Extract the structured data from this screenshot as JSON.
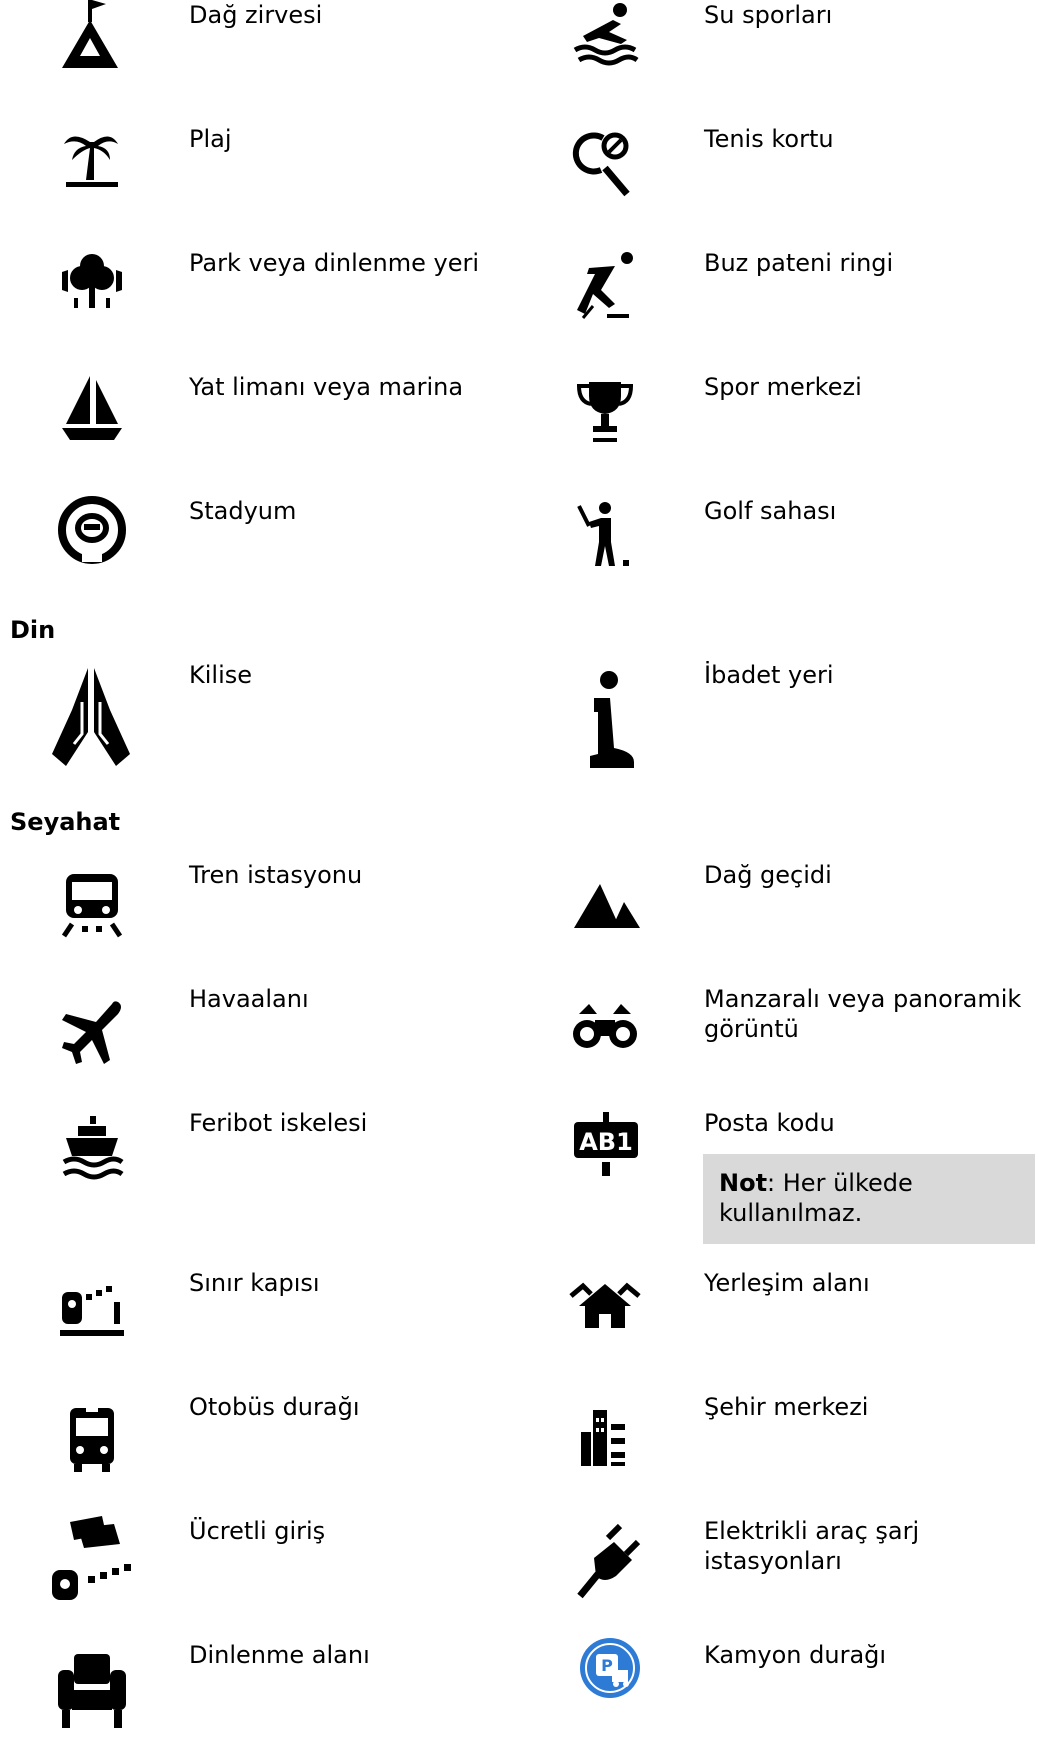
{
  "sections": {
    "religion": "Din",
    "travel": "Seyahat"
  },
  "labels": {
    "mountain_peak": "Dağ zirvesi",
    "water_sports": "Su sporları",
    "beach": "Plaj",
    "tennis_court": "Tenis kortu",
    "park": "Park veya dinlenme yeri",
    "ice_skating": "Buz pateni ringi",
    "marina": "Yat limanı veya marina",
    "sports_centre": "Spor merkezi",
    "stadium": "Stadyum",
    "golf_course": "Golf sahası",
    "church": "Kilise",
    "place_of_worship": "İbadet yeri",
    "train_station": "Tren istasyonu",
    "mountain_pass": "Dağ geçidi",
    "airport": "Havaalanı",
    "scenic_view": "Manzaralı veya panoramik görüntü",
    "ferry_terminal": "Feribot iskelesi",
    "postcode": "Posta kodu",
    "border_crossing": "Sınır kapısı",
    "residential_area": "Yerleşim alanı",
    "bus_stop": "Otobüs durağı",
    "city_centre": "Şehir merkezi",
    "toll_gate": "Ücretli giriş",
    "ev_charging": "Elektrikli araç şarj istasyonları",
    "rest_area": "Dinlenme alanı",
    "truck_stop": "Kamyon durağı"
  },
  "note": {
    "label": "Not",
    "text": ": Her ülkede kullanılmaz."
  },
  "postcode_badge": "AB1",
  "truck_stop_color": "#2e7bd6"
}
